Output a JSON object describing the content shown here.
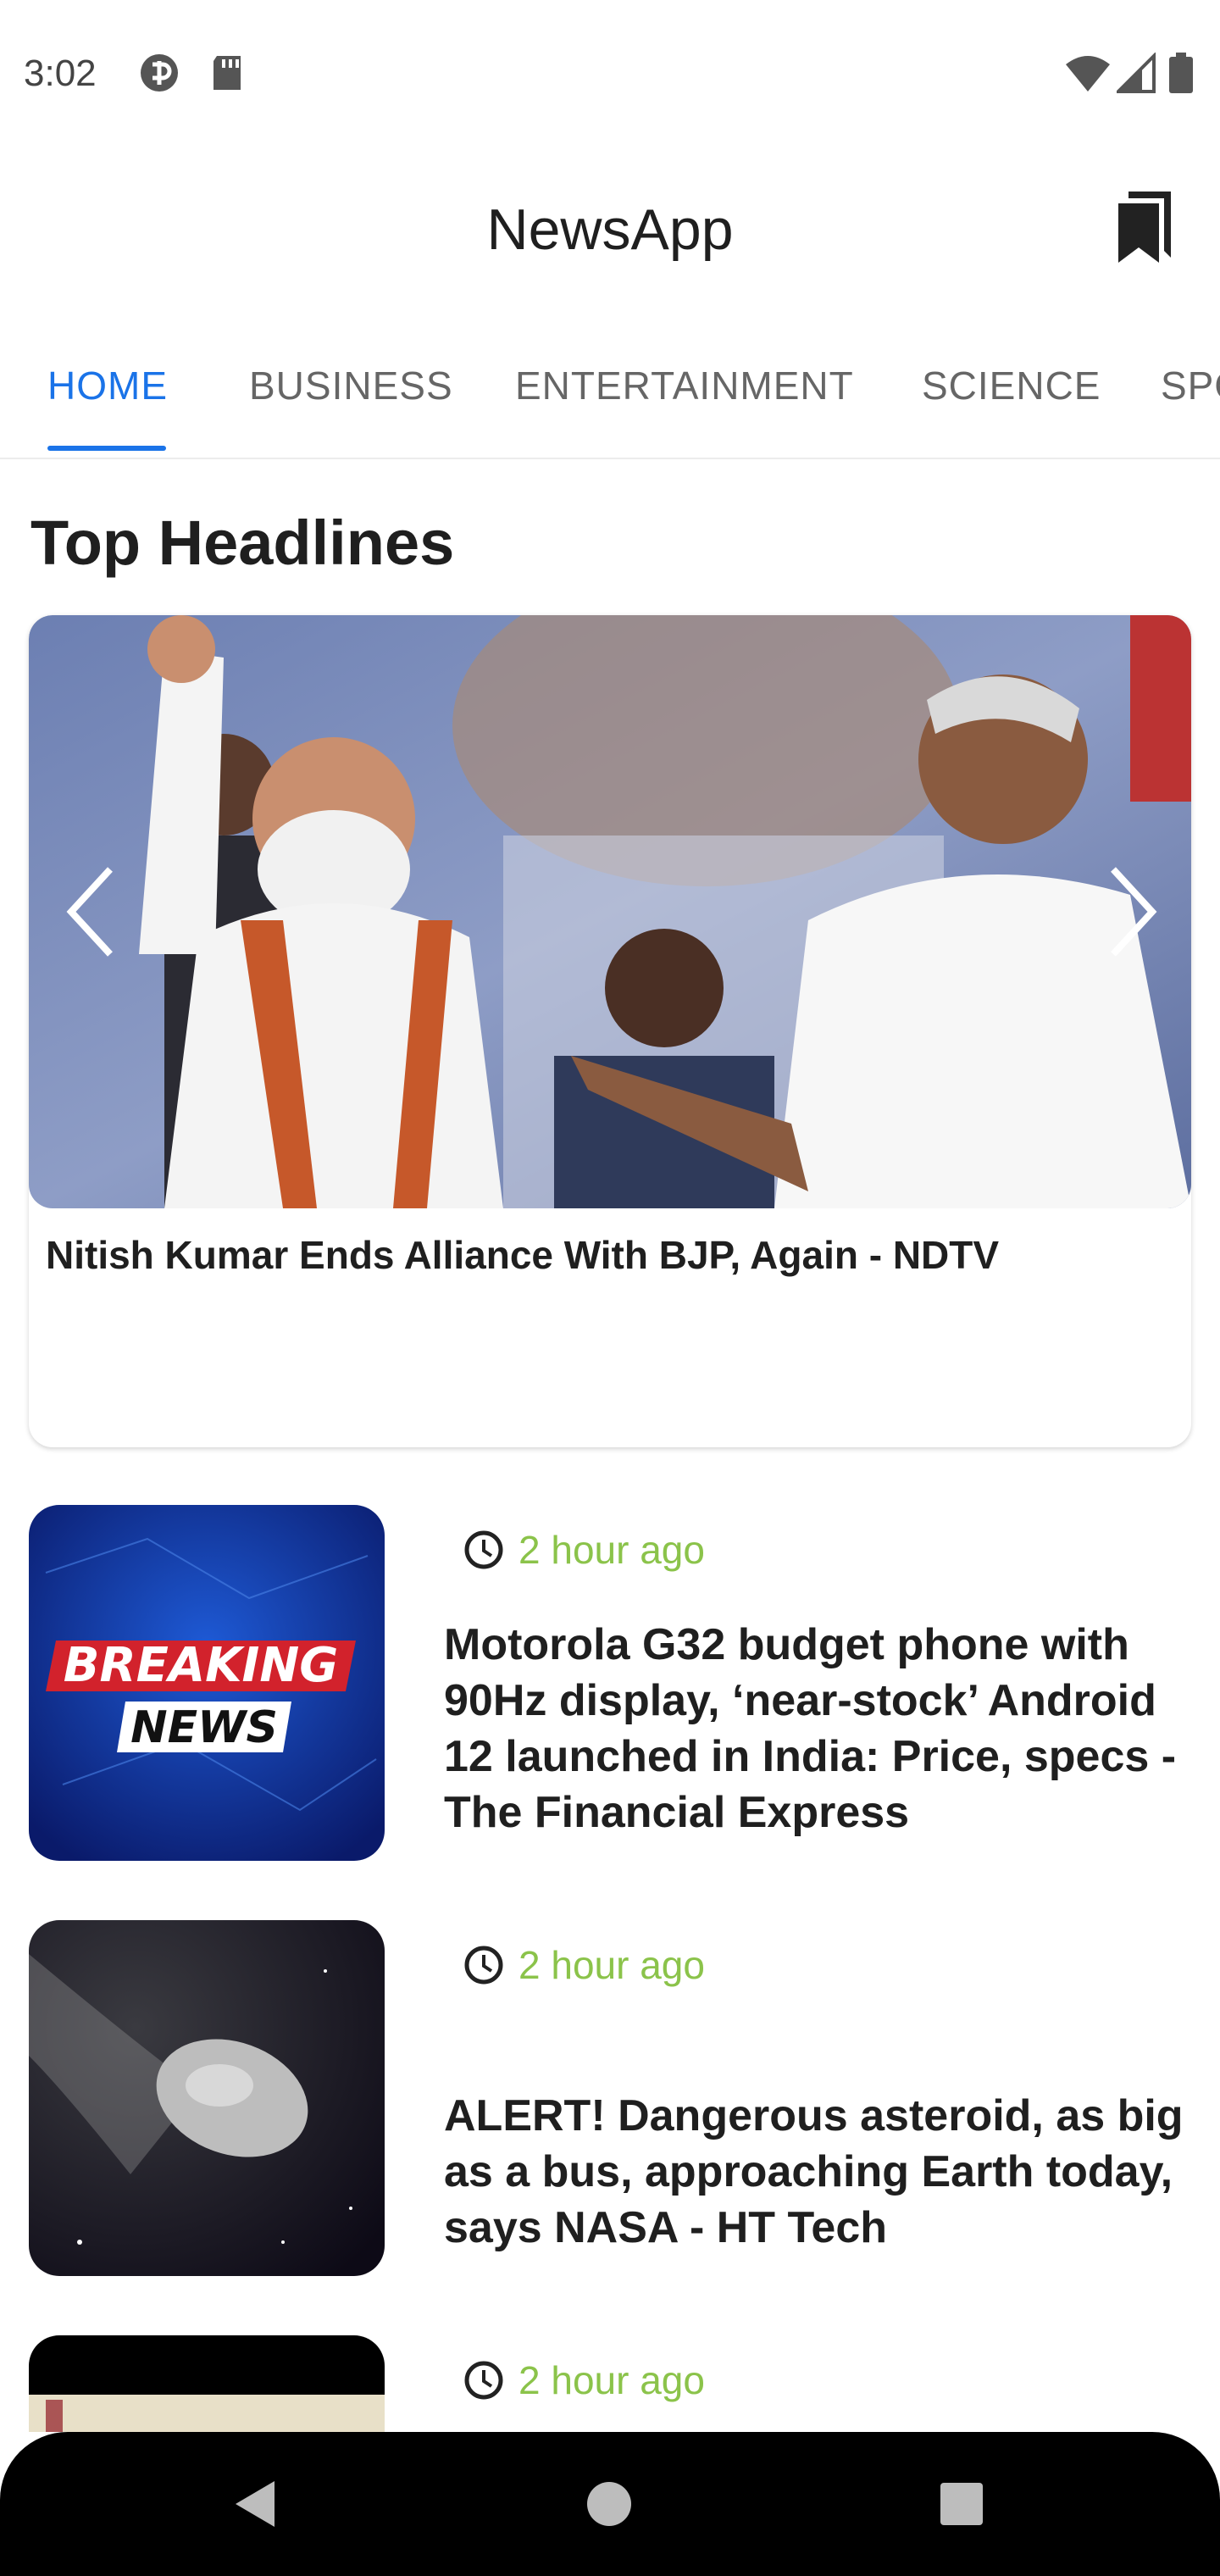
{
  "status_bar": {
    "time": "3:02",
    "left_icons": [
      "data-saver-icon",
      "sd-card-icon"
    ],
    "right_icons": [
      "wifi-icon",
      "cell-signal-icon",
      "battery-icon"
    ]
  },
  "app_bar": {
    "title": "NewsApp",
    "bookmark_icon": "bookmarks-icon"
  },
  "tabs": [
    {
      "label": "HOME",
      "active": true
    },
    {
      "label": "BUSINESS",
      "active": false
    },
    {
      "label": "ENTERTAINMENT",
      "active": false
    },
    {
      "label": "SCIENCE",
      "active": false
    },
    {
      "label": "SPORTS",
      "active": false
    }
  ],
  "top_headlines": {
    "section_title": "Top Headlines",
    "card": {
      "title": "Nitish Kumar Ends Alliance With BJP, Again - NDTV"
    }
  },
  "news": [
    {
      "time": "2 hour ago",
      "title": "Motorola G32 budget phone with 90Hz display, ‘near-stock’ Android 12 launched in India: Price, specs - The Financial Express",
      "thumb_line1": "BREAKING",
      "thumb_line2": "NEWS"
    },
    {
      "time": "2 hour ago",
      "title": "ALERT! Dangerous asteroid, as big as a bus, approaching Earth today, says NASA - HT Tech"
    },
    {
      "time": "2 hour ago",
      "title": ""
    }
  ],
  "colors": {
    "accent": "#1a73e8",
    "time_text": "#8bc34a",
    "nav_bar": "#000000"
  }
}
